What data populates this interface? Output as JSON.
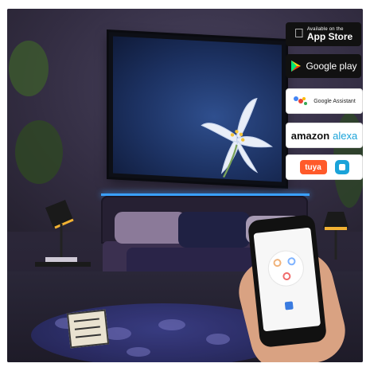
{
  "badges": {
    "app_store": {
      "small": "Available on the",
      "big": "App Store"
    },
    "google_play": {
      "label": "Google play"
    },
    "google_assistant": {
      "label": "Google Assistant"
    },
    "amazon": {
      "left": "amazon",
      "right": "alexa"
    },
    "tuya": {
      "label": "tuya"
    }
  },
  "colors": {
    "badge_dark": "#111111",
    "badge_light": "#ffffff",
    "alexa_blue": "#1aa3d9",
    "tuya_orange": "#ff5a2a",
    "tv_screen": "#1c3161",
    "led_strip": "#3aa0ff"
  }
}
